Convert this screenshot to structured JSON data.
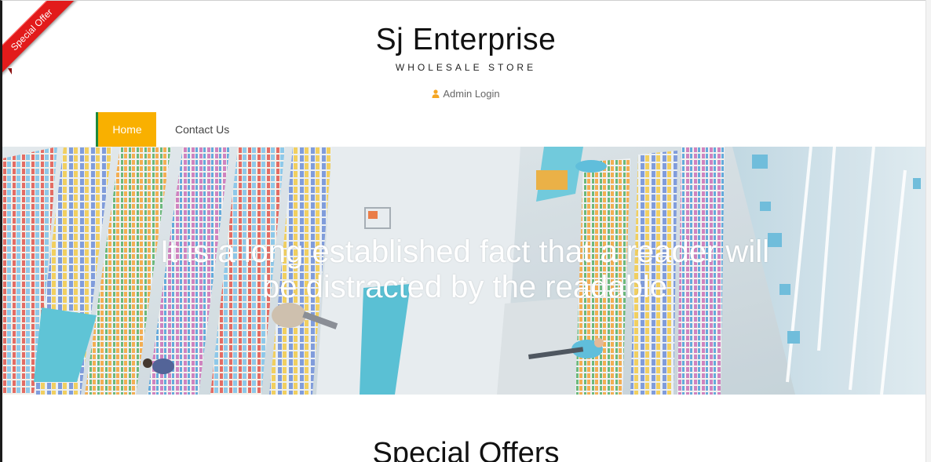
{
  "ribbon": {
    "label": "Special Offer"
  },
  "header": {
    "title": "Sj Enterprise",
    "subtitle": "WHOLESALE STORE",
    "admin_login": "Admin Login"
  },
  "nav": {
    "items": [
      {
        "label": "Home",
        "active": true
      },
      {
        "label": "Contact Us",
        "active": false
      }
    ]
  },
  "hero": {
    "caption": "It is a long established fact that a reader will be distracted by the readable"
  },
  "sections": {
    "special_offers_title": "Special Offers"
  },
  "colors": {
    "accent": "#f9b000",
    "ribbon": "#e21b1b",
    "active_border": "#1f8a3a"
  },
  "icons": {
    "admin_login": "user-icon"
  }
}
